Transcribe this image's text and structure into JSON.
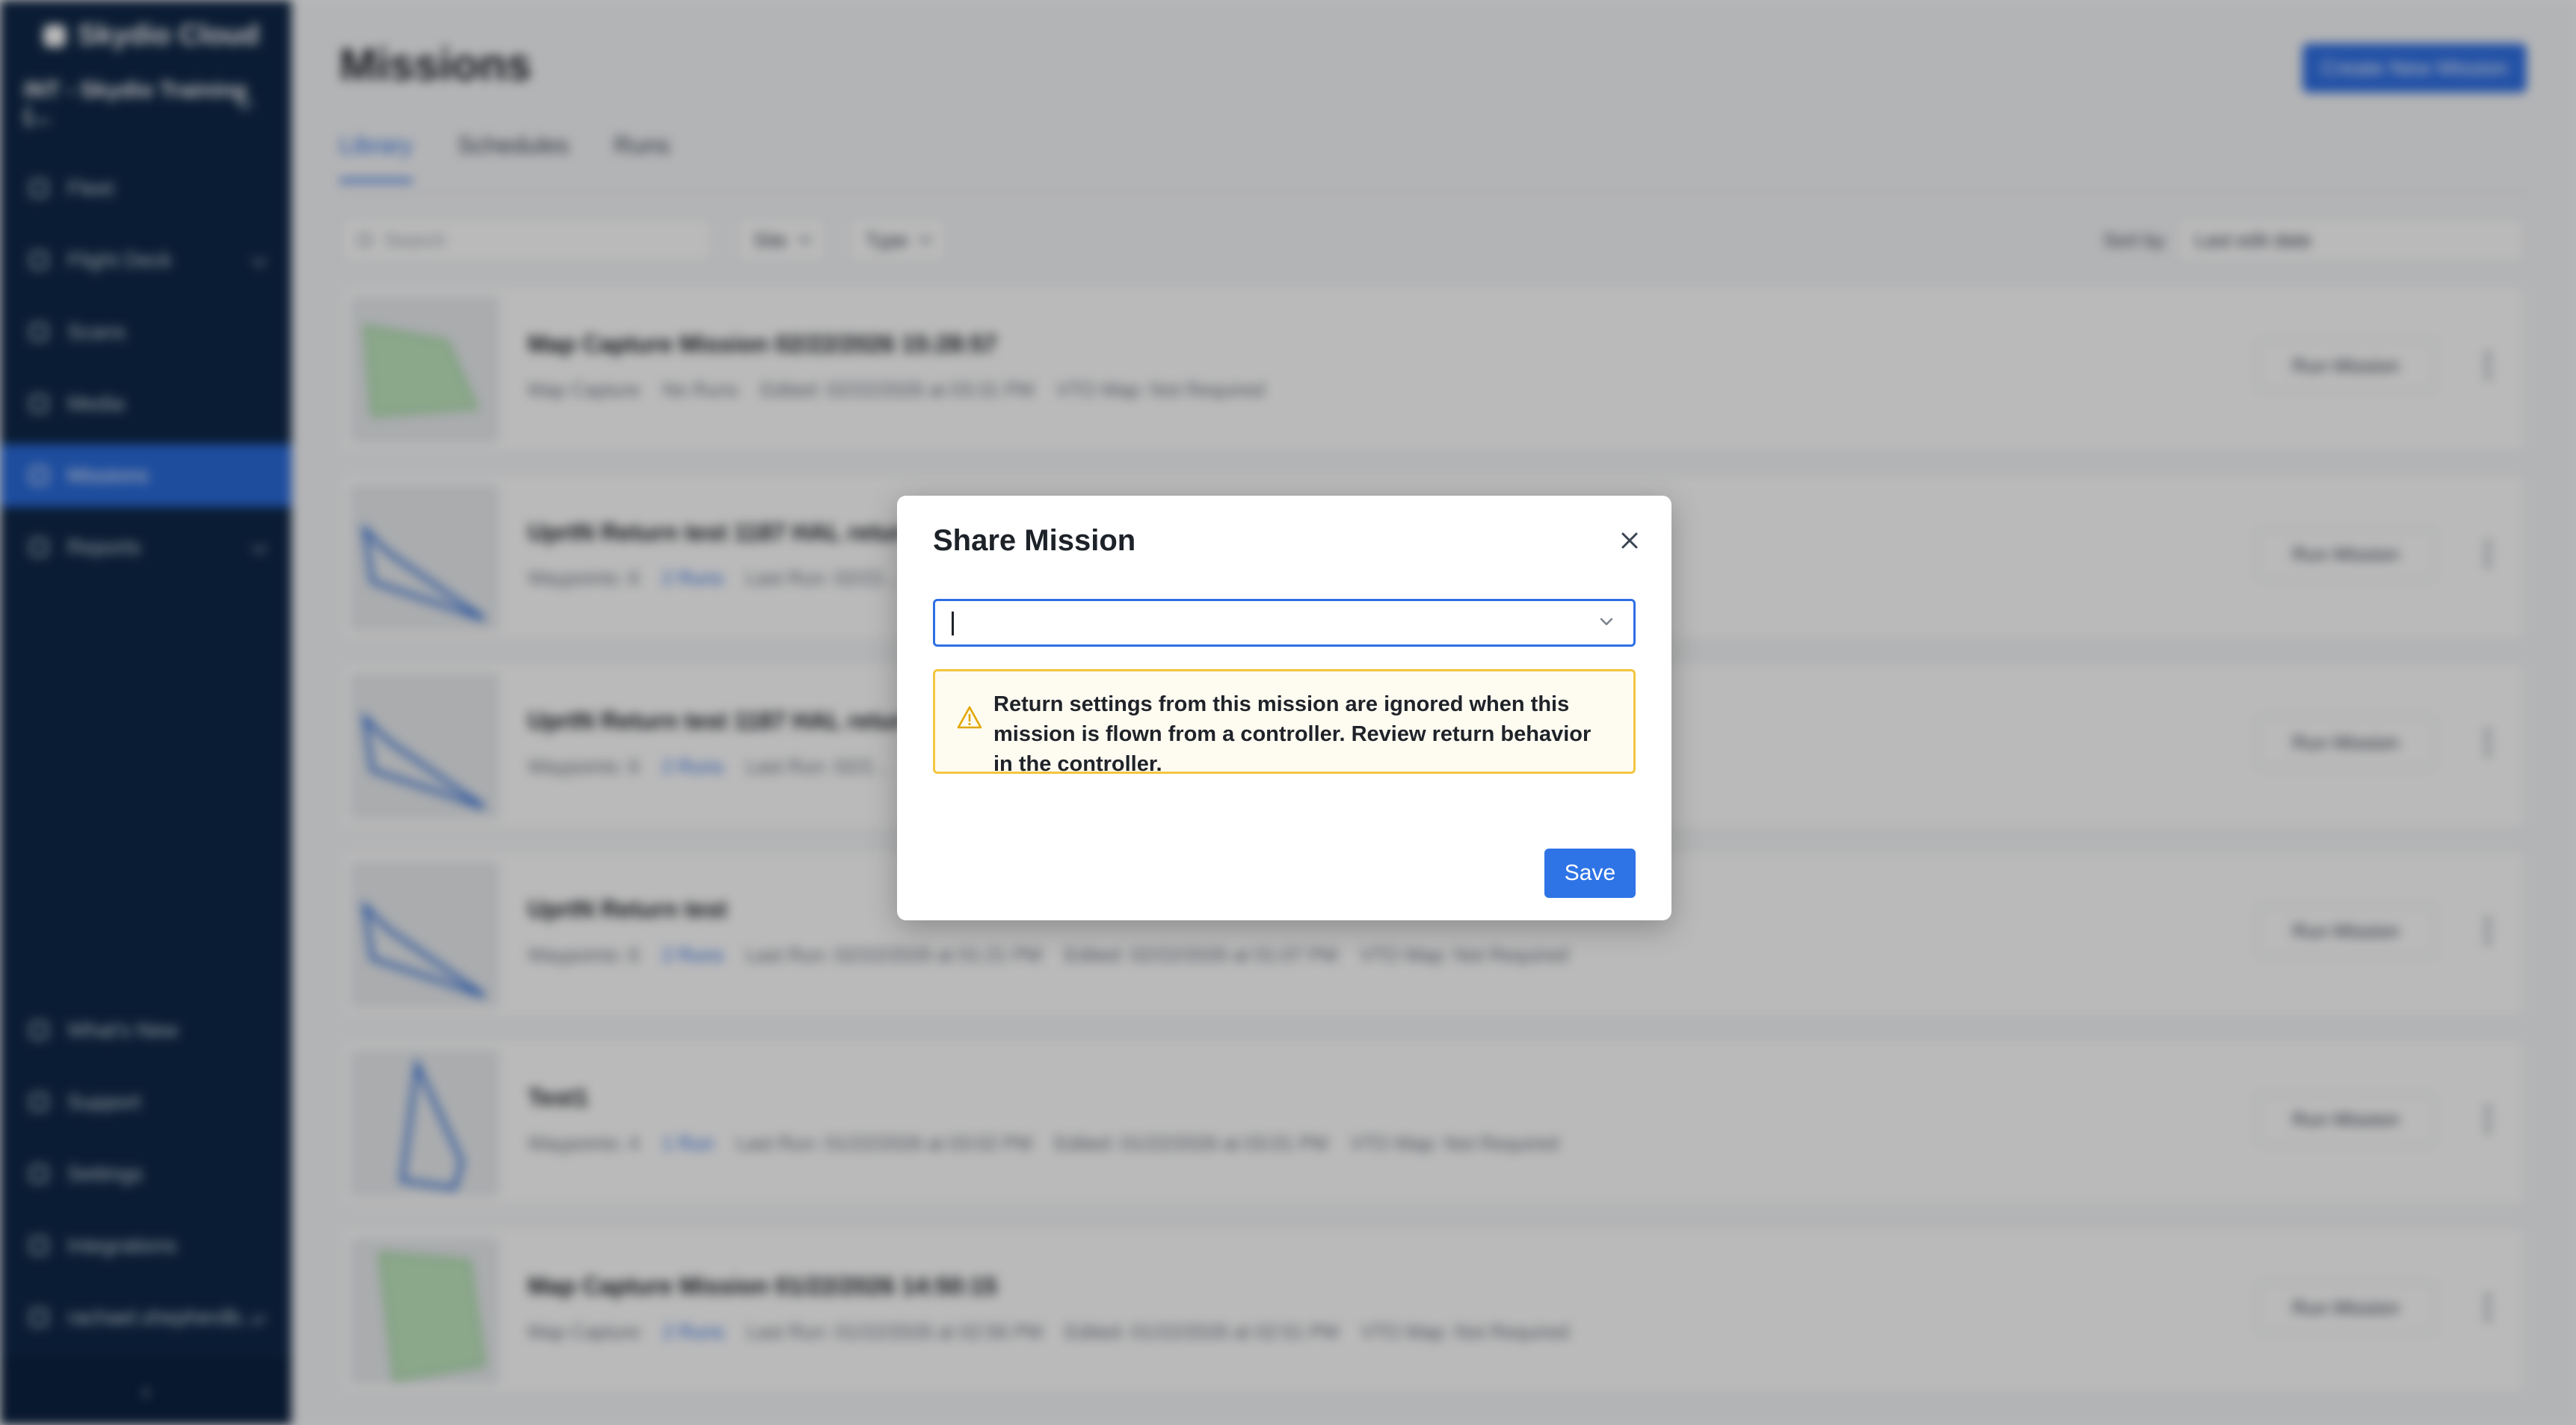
{
  "app": {
    "brand": "Skydio Cloud",
    "organization": "INT - Skydio Training (..."
  },
  "sidebar": {
    "items": [
      {
        "label": "Fleet",
        "icon": "fleet-icon"
      },
      {
        "label": "Flight Deck",
        "icon": "flight-deck-icon"
      },
      {
        "label": "Scans",
        "icon": "scans-icon"
      },
      {
        "label": "Media",
        "icon": "media-icon"
      },
      {
        "label": "Missions",
        "icon": "missions-icon",
        "active": true
      },
      {
        "label": "Reports",
        "icon": "reports-icon"
      }
    ],
    "bottom_items": [
      {
        "label": "What's New",
        "icon": "whats-new-icon"
      },
      {
        "label": "Support",
        "icon": "support-icon"
      },
      {
        "label": "Settings",
        "icon": "settings-icon"
      },
      {
        "label": "Integrations",
        "icon": "integrations-icon"
      },
      {
        "label": "rachael.shepherdb...",
        "icon": "user-icon"
      }
    ],
    "collapse_glyph": "‹"
  },
  "main": {
    "title": "Missions",
    "create_button": "Create New Mission",
    "tabs": [
      "Library",
      "Schedules",
      "Runs"
    ],
    "search_placeholder": "Search",
    "filters": [
      "Site",
      "Type"
    ],
    "sort_label": "Sort by",
    "sort_value": "Last edit date",
    "run_button": "Run Mission",
    "missions": [
      {
        "title": "Map Capture Mission 02/22/2026 15:28:57",
        "meta": [
          "Map Capture",
          "No Runs",
          "Edited: 02/22/2026 at 03:31 PM",
          "VTO Map: Not Required"
        ]
      },
      {
        "title": "UprtN Return test 1187 HAL return ...",
        "meta": [
          "Waypoints: 6",
          "2 Runs",
          "Last Run: 02/22..."
        ]
      },
      {
        "title": "UprtN Return test 1187 HAL return ...",
        "meta": [
          "Waypoints: 6",
          "2 Runs",
          "Last Run: 02/2..."
        ]
      },
      {
        "title": "UprtN Return test",
        "meta": [
          "Waypoints: 6",
          "2 Runs",
          "Last Run: 02/22/2026 at 01:21 PM",
          "Edited: 02/22/2026 at 01:07 PM",
          "VTO Map: Not Required"
        ]
      },
      {
        "title": "Test1",
        "meta": [
          "Waypoints: 4",
          "1 Run",
          "Last Run: 01/22/2026 at 03:02 PM",
          "Edited: 01/22/2026 at 03:01 PM",
          "VTO Map: Not Required"
        ]
      },
      {
        "title": "Map Capture Mission 01/22/2026 14:50:15",
        "meta": [
          "Map Capture",
          "2 Runs",
          "Last Run: 01/22/2026 at 02:56 PM",
          "Edited: 01/22/2026 at 02:51 PM",
          "VTO Map: Not Required"
        ]
      }
    ]
  },
  "modal": {
    "title": "Share Mission",
    "select": {
      "value": "",
      "placeholder": ""
    },
    "warning": "Return settings from this mission are ignored when this mission is flown from a controller. Review return behavior in the controller.",
    "save_label": "Save"
  },
  "colors": {
    "sidebar_bg": "#0f2747",
    "accent": "#2f6fe4",
    "warning_border": "#f2c640",
    "warning_bg": "#fefbf1"
  }
}
